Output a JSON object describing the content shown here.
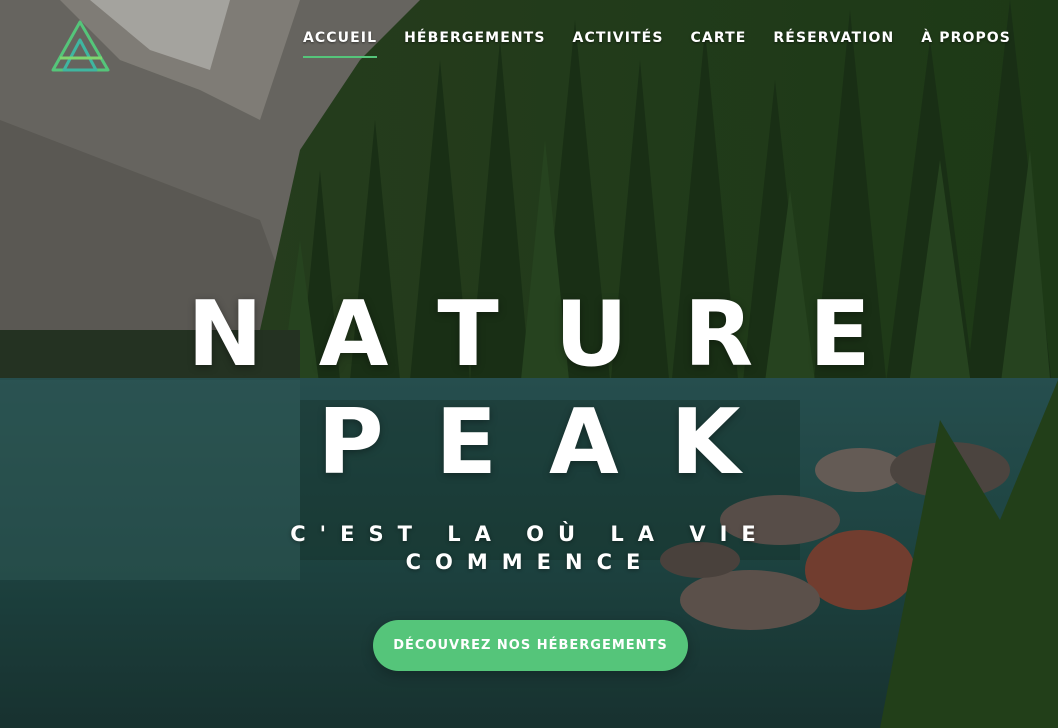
{
  "brand": {
    "logo_icon": "mountain-triangle-logo-icon",
    "accent": "#55c57a"
  },
  "nav": {
    "items": [
      {
        "label": "ACCUEIL",
        "active": true
      },
      {
        "label": "HÉBERGEMENTS"
      },
      {
        "label": "ACTIVITÉS"
      },
      {
        "label": "CARTE"
      },
      {
        "label": "RÉSERVATION"
      },
      {
        "label": "À PROPOS"
      }
    ]
  },
  "hero": {
    "title_line1": "NATURE",
    "title_line2": "PEAK",
    "tagline": "C'EST LA OÙ LA VIE COMMENCE",
    "cta_label": "DÉCOUVREZ NOS HÉBERGEMENTS"
  }
}
